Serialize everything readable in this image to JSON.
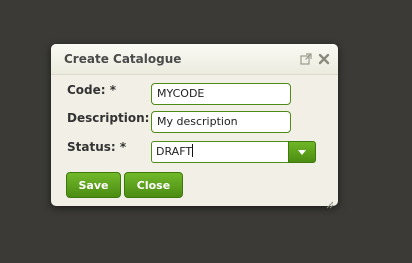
{
  "dialog": {
    "title": "Create Catalogue",
    "icons": {
      "popout": "popout-icon",
      "close": "close-icon",
      "resize": "resize-grip-icon"
    }
  },
  "form": {
    "code": {
      "label": "Code: *",
      "value": "MYCODE"
    },
    "description": {
      "label": "Description: *",
      "value": "My description"
    },
    "status": {
      "label": "Status: *",
      "value": "DRAFT"
    }
  },
  "buttons": {
    "save_label": "Save",
    "close_label": "Close"
  },
  "colors": {
    "accent": "#5a9e1c",
    "background": "#3b3a36",
    "dialog": "#f2f0e6"
  }
}
